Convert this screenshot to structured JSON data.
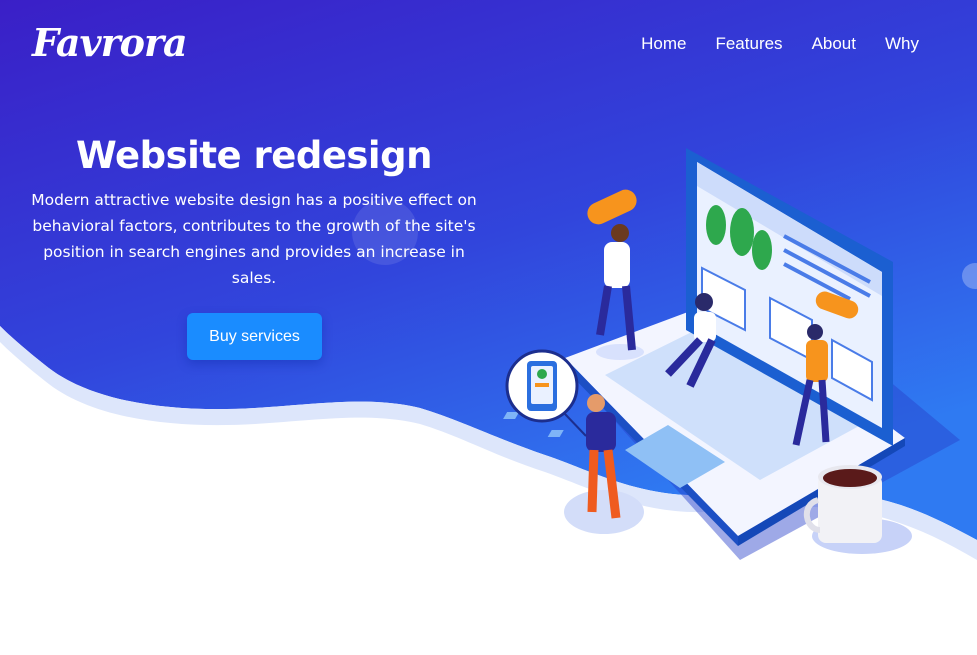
{
  "brand": {
    "logo_text": "Favrora"
  },
  "nav": {
    "items": [
      {
        "label": "Home"
      },
      {
        "label": "Features"
      },
      {
        "label": "About"
      },
      {
        "label": "Why"
      }
    ]
  },
  "hero": {
    "title": "Website redesign",
    "description": "Modern attractive website design has a positive effect on behavioral factors, contributes to the growth of the site's position in search engines and provides an increase in sales.",
    "cta_label": "Buy services"
  },
  "colors": {
    "gradient_top": "#3a1fc7",
    "gradient_bottom": "#2e6cf0",
    "button": "#1a8cff",
    "text": "#ffffff"
  }
}
